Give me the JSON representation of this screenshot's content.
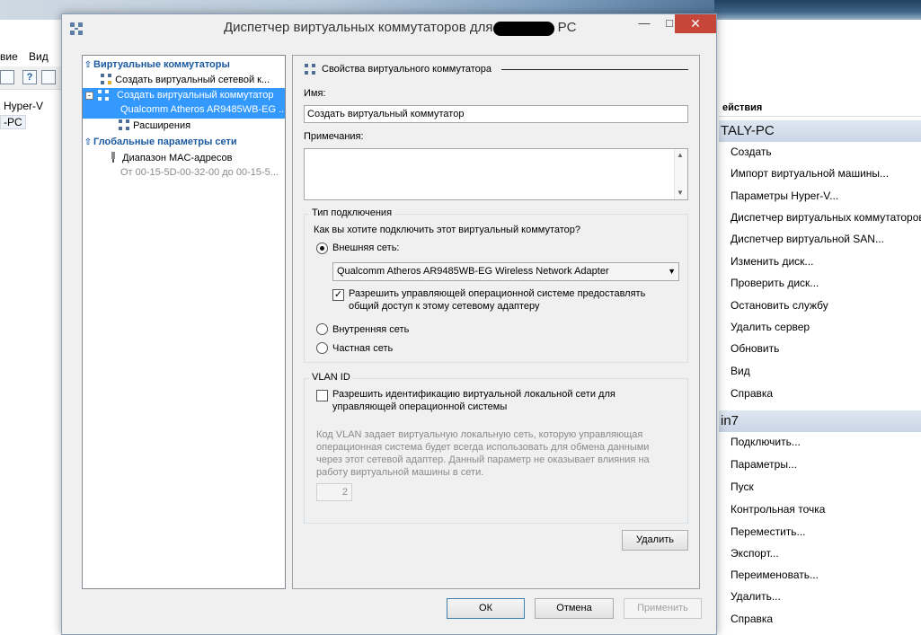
{
  "background": {
    "menu": [
      "вие",
      "Вид"
    ],
    "tree": [
      "Hyper-V",
      "-PC"
    ],
    "actions_header": "ействия",
    "group1": "TALY-PC",
    "group1_items": [
      "Создать",
      "Импорт виртуальной машины...",
      "Параметры Hyper-V...",
      "Диспетчер виртуальных коммутаторов...",
      "Диспетчер виртуальной SAN...",
      "Изменить диск...",
      "Проверить диск...",
      "Остановить службу",
      "Удалить сервер",
      "Обновить",
      "Вид",
      "Справка"
    ],
    "group2": "in7",
    "group2_items": [
      "Подключить...",
      "Параметры...",
      "Пуск",
      "Контрольная точка",
      "Переместить...",
      "Экспорт...",
      "Переименовать...",
      "Удалить...",
      "Справка"
    ]
  },
  "dialog": {
    "title_prefix": "Диспетчер виртуальных коммутаторов для",
    "title_suffix": "PC",
    "tree": {
      "section1": "Виртуальные коммутаторы",
      "item_create_network": "Создать виртуальный сетевой к...",
      "item_selected_line1": "Создать виртуальный коммутатор",
      "item_selected_line2": "Qualcomm Atheros AR9485WB-EG ...",
      "item_extensions": "Расширения",
      "section2": "Глобальные параметры сети",
      "item_mac": "Диапазон MAC-адресов",
      "item_mac_sub": "От 00-15-5D-00-32-00 до 00-15-5..."
    },
    "props": {
      "heading": "Свойства виртуального коммутатора",
      "name_label": "Имя:",
      "name_value": "Создать виртуальный коммутатор",
      "notes_label": "Примечания:",
      "notes_value": "",
      "conn_group": "Тип подключения",
      "conn_question": "Как вы хотите подключить этот виртуальный коммутатор?",
      "external": "Внешняя сеть:",
      "adapter": "Qualcomm Atheros AR9485WB-EG Wireless Network Adapter",
      "allow_os_line1": "Разрешить управляющей операционной системе предоставлять",
      "allow_os_line2": "общий доступ к этому сетевому адаптеру",
      "internal": "Внутренняя сеть",
      "private": "Частная сеть",
      "vlan_group": "VLAN ID",
      "vlan_check_line1": "Разрешить идентификацию виртуальной локальной сети для",
      "vlan_check_line2": "управляющей операционной системы",
      "vlan_desc": [
        "Код VLAN задает виртуальную локальную сеть, которую управляющая",
        "операционная система будет всегда использовать для обмена данными",
        "через этот сетевой адаптер. Данный параметр не оказывает влияния на",
        "работу виртуальной машины в сети."
      ],
      "vlan_value": "2",
      "delete": "Удалить"
    },
    "buttons": {
      "ok": "ОК",
      "cancel": "Отмена",
      "apply": "Применить"
    }
  }
}
